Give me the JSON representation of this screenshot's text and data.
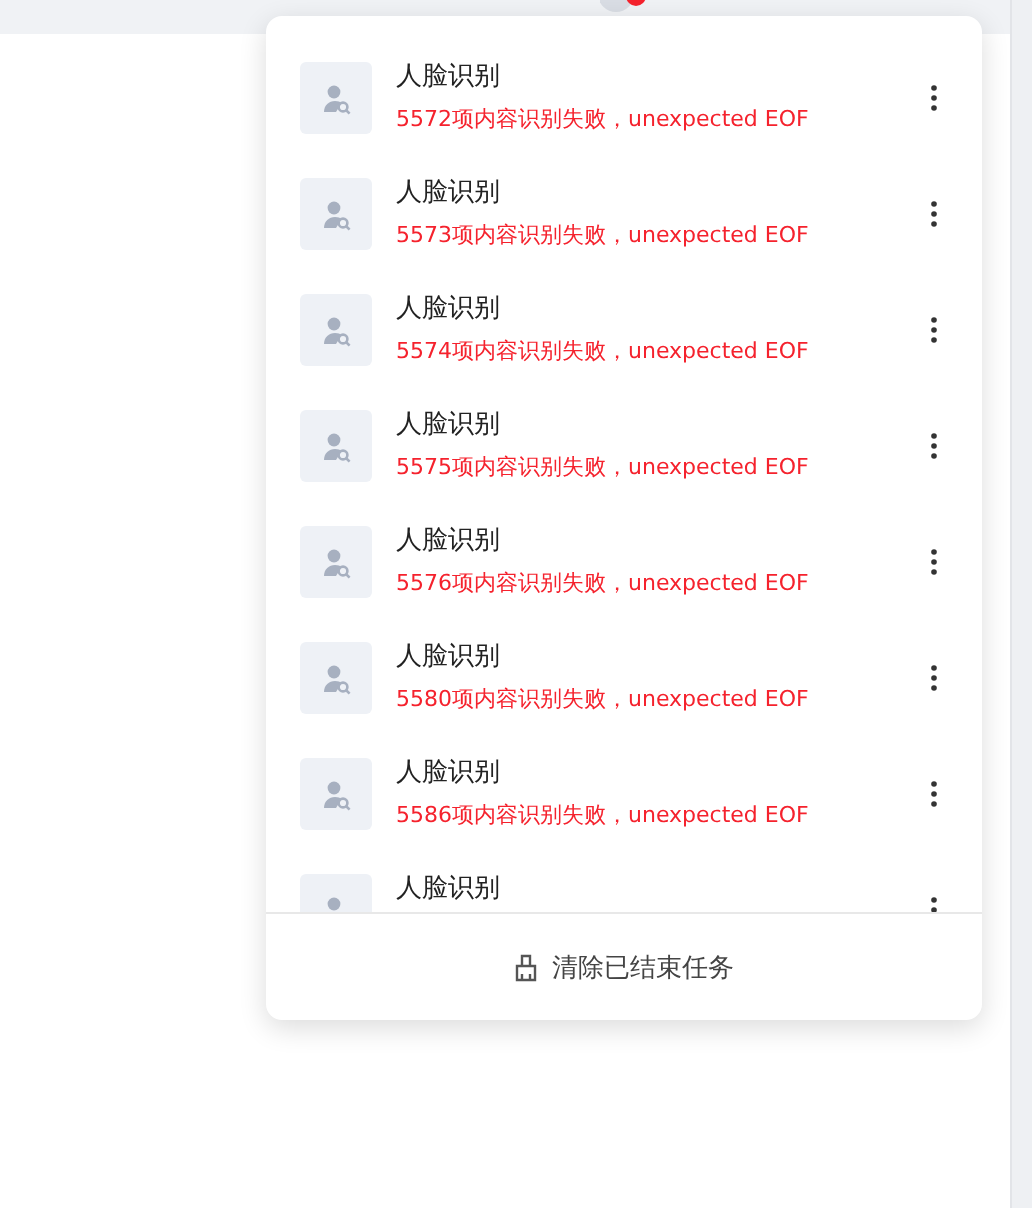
{
  "tasks": [
    {
      "title": "人脸识别",
      "message": "5572项内容识别失败，unexpected EOF"
    },
    {
      "title": "人脸识别",
      "message": "5573项内容识别失败，unexpected EOF"
    },
    {
      "title": "人脸识别",
      "message": "5574项内容识别失败，unexpected EOF"
    },
    {
      "title": "人脸识别",
      "message": "5575项内容识别失败，unexpected EOF"
    },
    {
      "title": "人脸识别",
      "message": "5576项内容识别失败，unexpected EOF"
    },
    {
      "title": "人脸识别",
      "message": "5580项内容识别失败，unexpected EOF"
    },
    {
      "title": "人脸识别",
      "message": "5586项内容识别失败，unexpected EOF"
    },
    {
      "title": "人脸识别"
    }
  ],
  "footer_button": {
    "label": "清除已结束任务"
  }
}
